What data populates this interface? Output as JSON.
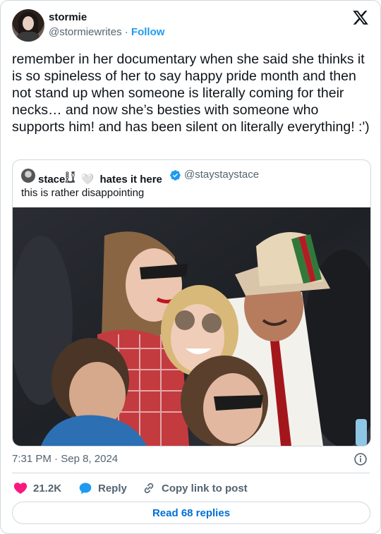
{
  "author": {
    "name": "stormie",
    "handle": "@stormiewrites",
    "separator": "·",
    "follow_label": "Follow"
  },
  "tweet": {
    "text": "remember in her documentary when she said she thinks it is so spineless of her to say happy pride month and then not stand up when someone is literally coming for their necks… and now she’s besties with someone who supports him! and has been silent on literally everything! :')"
  },
  "quoted": {
    "name": "stace𓏀",
    "heart": "🤍",
    "name_suffix": "hates it here",
    "handle": "@staystaystace",
    "text": "this is rather disappointing"
  },
  "footer": {
    "time": "7:31 PM",
    "separator": "·",
    "date": "Sep 8, 2024",
    "likes": "21.2K",
    "reply_label": "Reply",
    "copy_label": "Copy link to post",
    "read_replies": "Read 68 replies"
  },
  "icons": {
    "platform": "x-logo-icon",
    "verified": "verified-badge-icon",
    "info": "info-icon",
    "like": "heart-icon",
    "reply": "reply-bubble-icon",
    "copy": "link-icon"
  },
  "colors": {
    "accent": "#1d9bf0",
    "like": "#f91880",
    "read_link": "#006fd6",
    "muted": "#536471",
    "border": "#cfd9de"
  }
}
